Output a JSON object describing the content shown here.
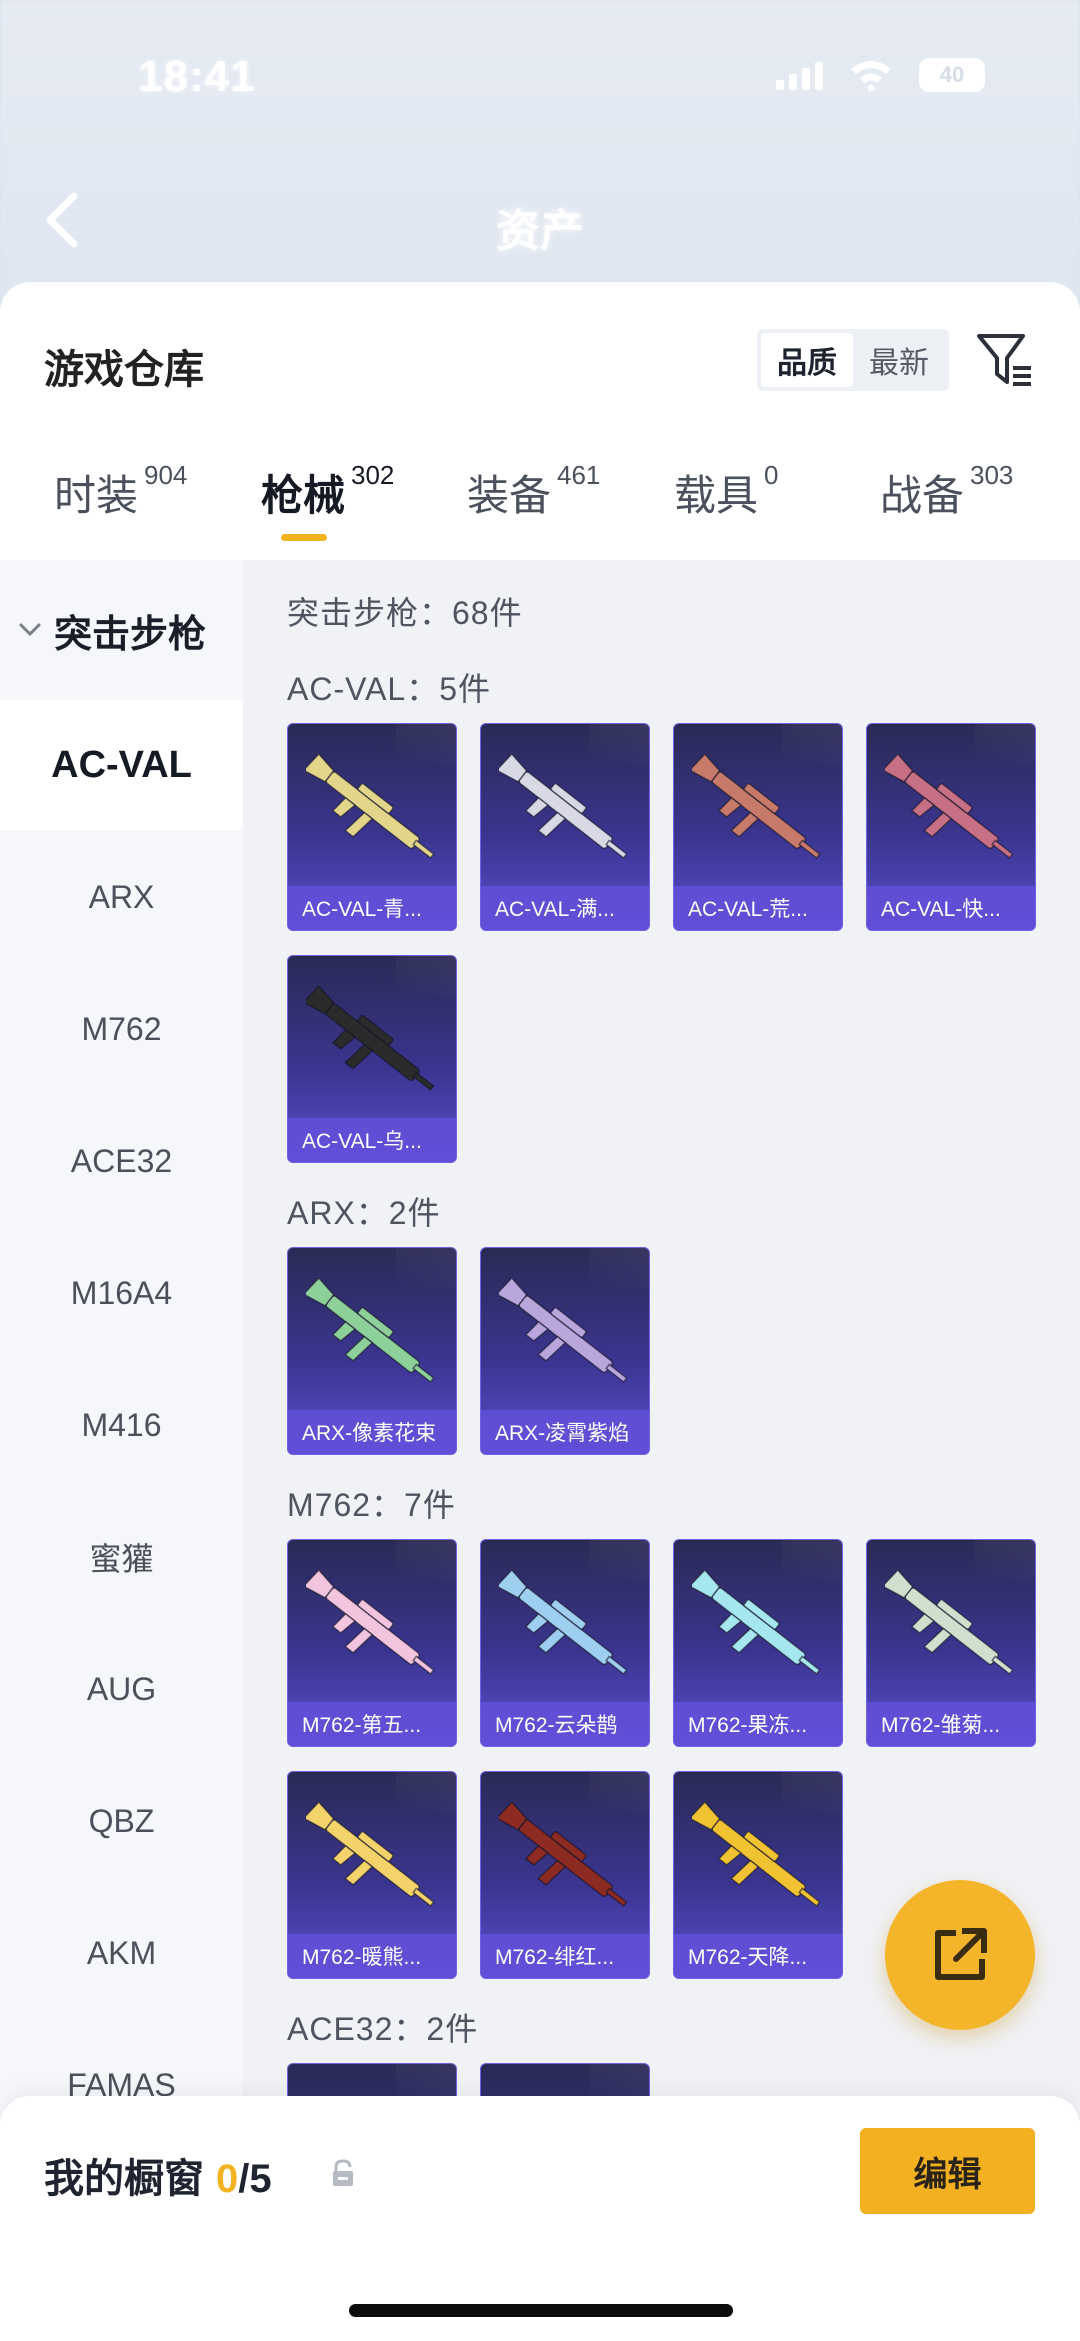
{
  "status_bar": {
    "time": "18:41",
    "battery": "40"
  },
  "header": {
    "title": "资产"
  },
  "sheet": {
    "title": "游戏仓库",
    "sort_options": [
      "品质",
      "最新"
    ],
    "active_sort": "品质"
  },
  "tabs": [
    {
      "label": "时装",
      "count": "904"
    },
    {
      "label": "枪械",
      "count": "302"
    },
    {
      "label": "装备",
      "count": "461"
    },
    {
      "label": "载具",
      "count": "0"
    },
    {
      "label": "战备",
      "count": "303"
    }
  ],
  "sidebar": {
    "category": "突击步枪",
    "items": [
      "AC-VAL",
      "ARX",
      "M762",
      "ACE32",
      "M16A4",
      "M416",
      "蜜獾",
      "AUG",
      "QBZ",
      "AKM",
      "FAMAS"
    ]
  },
  "content": {
    "summary": "突击步枪：68件",
    "groups": [
      {
        "heading": "AC-VAL：5件",
        "items": [
          "AC-VAL-青...",
          "AC-VAL-满...",
          "AC-VAL-荒...",
          "AC-VAL-快...",
          "AC-VAL-乌..."
        ]
      },
      {
        "heading": "ARX：2件",
        "items": [
          "ARX-像素花束",
          "ARX-凌霄紫焰"
        ]
      },
      {
        "heading": "M762：7件",
        "items": [
          "M762-第五...",
          "M762-云朵鹊",
          "M762-果冻...",
          "M762-雏菊...",
          "M762-暖熊...",
          "M762-绯红...",
          "M762-天降..."
        ]
      },
      {
        "heading": "ACE32：2件",
        "items": []
      }
    ],
    "skin_colors": [
      "#e3d68a",
      "#d9d9e6",
      "#c77a6a",
      "#c76f84",
      "#2b2b2b",
      "#8ed09a",
      "#b9a6dd",
      "#f2c4dd",
      "#9ecff0",
      "#a6e6ee",
      "#cfe0cf",
      "#f5d36b",
      "#8d2a22",
      "#f1c232"
    ]
  },
  "bottom_bar": {
    "title": "我的橱窗",
    "current": "0",
    "max": "/5",
    "edit_label": "编辑"
  }
}
